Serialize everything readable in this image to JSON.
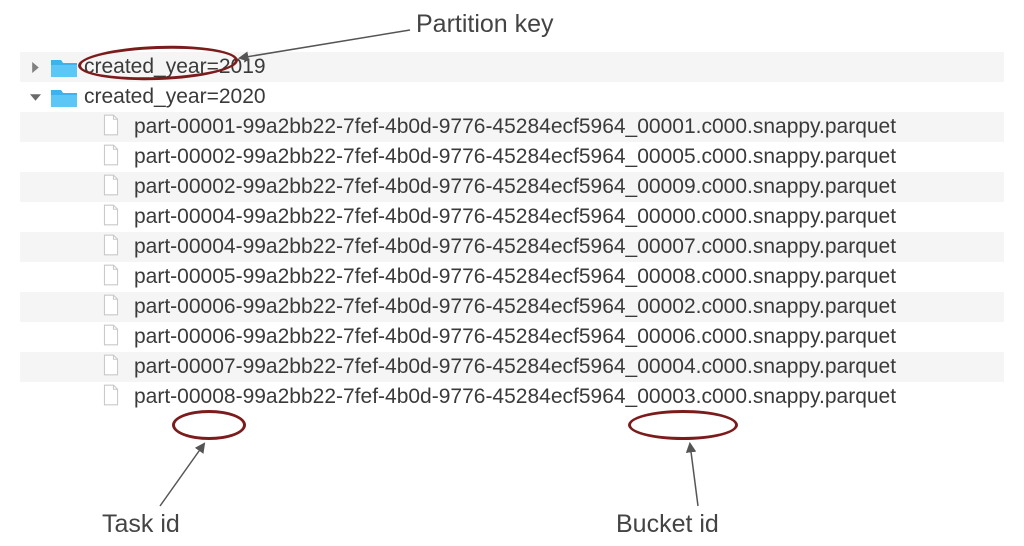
{
  "labels": {
    "partitionKey": "Partition key",
    "taskId": "Task id",
    "bucketId": "Bucket id"
  },
  "folders": {
    "first": "created_year=2019",
    "second": "created_year=2020"
  },
  "files": [
    "part-00001-99a2bb22-7fef-4b0d-9776-45284ecf5964_00001.c000.snappy.parquet",
    "part-00002-99a2bb22-7fef-4b0d-9776-45284ecf5964_00005.c000.snappy.parquet",
    "part-00002-99a2bb22-7fef-4b0d-9776-45284ecf5964_00009.c000.snappy.parquet",
    "part-00004-99a2bb22-7fef-4b0d-9776-45284ecf5964_00000.c000.snappy.parquet",
    "part-00004-99a2bb22-7fef-4b0d-9776-45284ecf5964_00007.c000.snappy.parquet",
    "part-00005-99a2bb22-7fef-4b0d-9776-45284ecf5964_00008.c000.snappy.parquet",
    "part-00006-99a2bb22-7fef-4b0d-9776-45284ecf5964_00002.c000.snappy.parquet",
    "part-00006-99a2bb22-7fef-4b0d-9776-45284ecf5964_00006.c000.snappy.parquet",
    "part-00007-99a2bb22-7fef-4b0d-9776-45284ecf5964_00004.c000.snappy.parquet",
    "part-00008-99a2bb22-7fef-4b0d-9776-45284ecf5964_00003.c000.snappy.parquet"
  ]
}
